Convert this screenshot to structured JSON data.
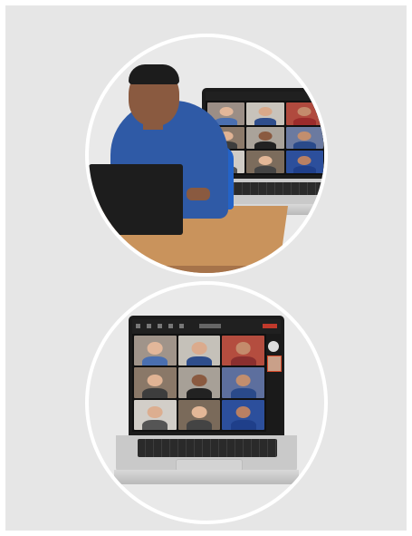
{
  "scene_top": {
    "description_icon": "person-using-laptop-video-call",
    "tiles": [
      {
        "skin": "#e2b79a",
        "shirt": "#4a6fb0",
        "bg": "#9b8e86"
      },
      {
        "skin": "#d9a98a",
        "shirt": "#2f4e8c",
        "bg": "#c8c3bb"
      },
      {
        "skin": "#c48b6c",
        "shirt": "#9b2b2b",
        "bg": "#b04a3e"
      },
      {
        "skin": "#e0b394",
        "shirt": "#3d3d3d",
        "bg": "#8c7a6a"
      },
      {
        "skin": "#8a5a40",
        "shirt": "#222",
        "bg": "#aaa39a"
      },
      {
        "skin": "#c28e6e",
        "shirt": "#2a4a8a",
        "bg": "#6b7aa0"
      },
      {
        "skin": "#dcae90",
        "shirt": "#555",
        "bg": "#d0ccc6"
      },
      {
        "skin": "#e3b797",
        "shirt": "#444",
        "bg": "#7c6c5c"
      },
      {
        "skin": "#b98063",
        "shirt": "#1f3f8a",
        "bg": "#2c4f9c"
      }
    ],
    "colors": {
      "shirt": "#2f5aa6",
      "table": "#c9935c",
      "chair": "#2363c8"
    }
  },
  "scene_bottom": {
    "description_icon": "laptop-video-conference-grid",
    "tiles": [
      {
        "skin": "#e2b79a",
        "shirt": "#4a6fb0",
        "bg": "#a0948a"
      },
      {
        "skin": "#dbab8d",
        "shirt": "#2f4e8c",
        "bg": "#c5c1b9"
      },
      {
        "skin": "#c48b6c",
        "shirt": "#8a2f2f",
        "bg": "#b44d3f"
      },
      {
        "skin": "#e0b394",
        "shirt": "#3d3d3d",
        "bg": "#8a7868"
      },
      {
        "skin": "#8a5a40",
        "shirt": "#222",
        "bg": "#a7a097"
      },
      {
        "skin": "#c28e6e",
        "shirt": "#2a4a8a",
        "bg": "#5d6f9e"
      },
      {
        "skin": "#dcae90",
        "shirt": "#555",
        "bg": "#d2cec8"
      },
      {
        "skin": "#e3b797",
        "shirt": "#444",
        "bg": "#7a6a5a"
      },
      {
        "skin": "#b98063",
        "shirt": "#1f3f8a",
        "bg": "#2c4f9c"
      }
    ]
  }
}
